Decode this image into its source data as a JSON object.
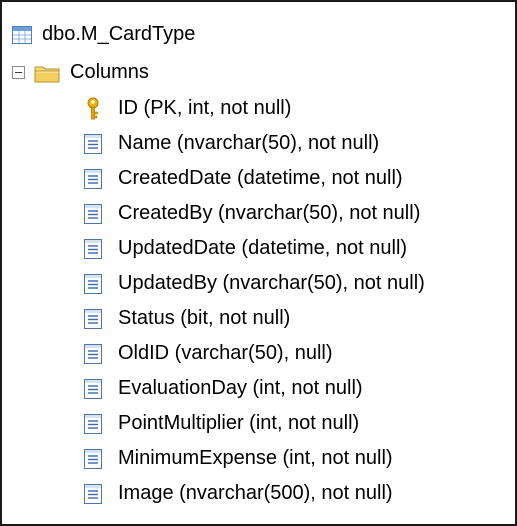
{
  "tree": {
    "table": {
      "label": "dbo.M_CardType",
      "icon": "table-icon"
    },
    "folder": {
      "label": "Columns",
      "icon": "folder-icon",
      "expander": "collapse-minus",
      "expanded": true
    },
    "columns": [
      {
        "label": "ID (PK, int, not null)",
        "icon": "key-icon"
      },
      {
        "label": "Name (nvarchar(50), not null)",
        "icon": "column-icon"
      },
      {
        "label": "CreatedDate (datetime, not null)",
        "icon": "column-icon"
      },
      {
        "label": "CreatedBy (nvarchar(50), not null)",
        "icon": "column-icon"
      },
      {
        "label": "UpdatedDate (datetime, not null)",
        "icon": "column-icon"
      },
      {
        "label": "UpdatedBy (nvarchar(50), not null)",
        "icon": "column-icon"
      },
      {
        "label": "Status (bit, not null)",
        "icon": "column-icon"
      },
      {
        "label": "OldID (varchar(50), null)",
        "icon": "column-icon"
      },
      {
        "label": "EvaluationDay (int, not null)",
        "icon": "column-icon"
      },
      {
        "label": "PointMultiplier (int, not null)",
        "icon": "column-icon"
      },
      {
        "label": "MinimumExpense (int, not null)",
        "icon": "column-icon"
      },
      {
        "label": "Image (nvarchar(500), not null)",
        "icon": "column-icon"
      }
    ]
  },
  "colors": {
    "border": "#1a1a1a",
    "background": "#ffffff",
    "text": "#000000",
    "key": "#e0a800",
    "column_icon_blue": "#2f6fb3",
    "folder_yellow": "#f3d36b"
  }
}
